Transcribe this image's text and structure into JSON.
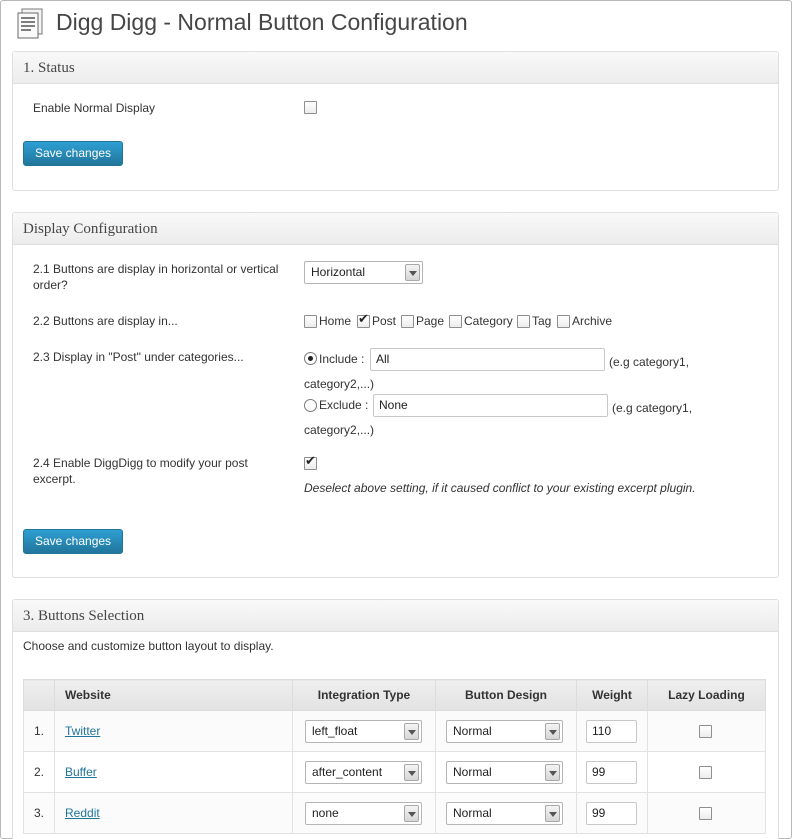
{
  "page": {
    "title": "Digg Digg - Normal Button Configuration",
    "icon": "document-pages-icon"
  },
  "status": {
    "title": "1. Status",
    "enable_label": "Enable Normal Display",
    "enable_checked": false,
    "save_label": "Save changes"
  },
  "display": {
    "title": "Display Configuration",
    "q1_label": "2.1 Buttons are display in horizontal or vertical order?",
    "q1_value": "Horizontal",
    "q2_label": "2.2 Buttons are display in...",
    "q2_options": [
      {
        "label": "Home",
        "checked": false
      },
      {
        "label": "Post",
        "checked": true
      },
      {
        "label": "Page",
        "checked": false
      },
      {
        "label": "Category",
        "checked": false
      },
      {
        "label": "Tag",
        "checked": false
      },
      {
        "label": "Archive",
        "checked": false
      }
    ],
    "q3_label": "2.3 Display in \"Post\" under categories...",
    "include_label": "Include :",
    "include_value": "All",
    "include_hint": "(e.g category1, category2,...)",
    "include_selected": true,
    "exclude_label": "Exclude :",
    "exclude_value": "None",
    "exclude_hint": "(e.g category1, category2,...)",
    "q4_label": "2.4 Enable DiggDigg to modify your post excerpt.",
    "q4_checked": true,
    "q4_note": "Deselect above setting, if it caused conflict to your existing excerpt plugin.",
    "save_label": "Save changes"
  },
  "selection": {
    "title": "3. Buttons Selection",
    "intro": "Choose and customize button layout to display.",
    "headers": [
      "",
      "Website",
      "Integration Type",
      "Button Design",
      "Weight",
      "Lazy Loading"
    ],
    "rows": [
      {
        "num": "1.",
        "site": "Twitter",
        "integration": "left_float",
        "design": "Normal",
        "weight": "110",
        "lazy": false
      },
      {
        "num": "2.",
        "site": "Buffer",
        "integration": "after_content",
        "design": "Normal",
        "weight": "99",
        "lazy": false
      },
      {
        "num": "3.",
        "site": "Reddit",
        "integration": "none",
        "design": "Normal",
        "weight": "99",
        "lazy": false
      }
    ]
  }
}
